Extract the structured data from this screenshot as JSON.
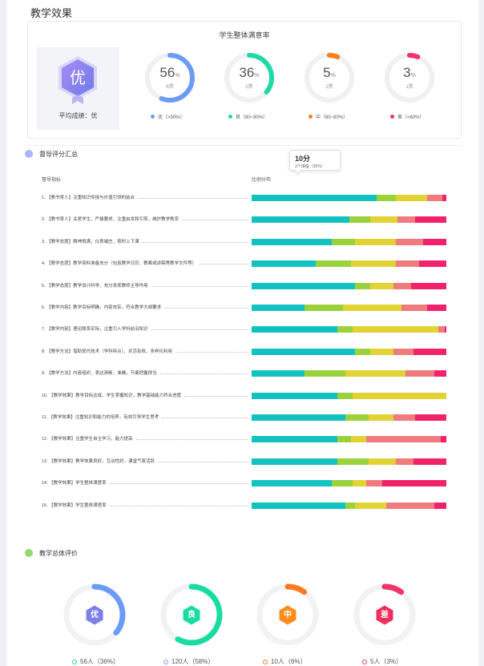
{
  "page": {
    "title": "教学效果"
  },
  "rate_card": {
    "title": "学生整体满意率",
    "grade": {
      "badge": "优",
      "avg_text": "平均成绩：优"
    },
    "donuts": [
      {
        "key": "excellent",
        "percent": 56,
        "unit": "%",
        "count": "6票",
        "color": "#6b9bf7"
      },
      {
        "key": "good",
        "percent": 36,
        "unit": "%",
        "count": "5票",
        "color": "#20d9a8"
      },
      {
        "key": "medium",
        "percent": 5,
        "unit": "%",
        "count": "2票",
        "color": "#fb7b21"
      },
      {
        "key": "poor",
        "percent": 3,
        "unit": "%",
        "count": "1票",
        "color": "#f0336a"
      }
    ],
    "legend": [
      {
        "text": "优（>90%）",
        "color": "#6b9bf7"
      },
      {
        "text": "良（80~90%）",
        "color": "#20d9a8"
      },
      {
        "text": "中（60~80%）",
        "color": "#fb7b21"
      },
      {
        "text": "差（<60%）",
        "color": "#f0336a"
      }
    ]
  },
  "supervision": {
    "heading": "督导评分汇总",
    "icon_color": "#a9b6f5",
    "col_indicator": "督导指标",
    "col_dist": "比例分布",
    "tooltip": {
      "main": "10分",
      "sub": "3个课程（36%）"
    },
    "segment_colors": [
      "#11c2c0",
      "#9bd23c",
      "#e2d334",
      "#ef7b7f",
      "#f2226a"
    ],
    "rows": [
      {
        "label": "1. 【教书育人】注重知识传授与价值引领的结合",
        "dist": [
          64,
          10,
          16,
          8,
          2
        ]
      },
      {
        "label": "2. 【教书育人】关爱学生，严格要求，注重启发和引导，维护教学秩序",
        "dist": [
          50,
          11,
          14,
          9,
          16
        ]
      },
      {
        "label": "3. 【教学态度】精神饱满，仪表端庄，按时上下课",
        "dist": [
          41,
          12,
          21,
          14,
          12
        ]
      },
      {
        "label": "4. 【教学态度】教学资料准备充分（包括教学日历、教案或讲稿等教学文件等）",
        "dist": [
          33,
          18,
          23,
          12,
          14
        ]
      },
      {
        "label": "5. 【教学态度】教学设计科学，充分发挥教师主导作用",
        "dist": [
          53,
          8,
          12,
          9,
          18
        ]
      },
      {
        "label": "6. 【教学内容】教学目标明确，内容充实，符合教学大纲要求",
        "dist": [
          27,
          20,
          30,
          13,
          10
        ]
      },
      {
        "label": "7. 【教学内容】理论联系实际，注重引入学科前沿知识",
        "dist": [
          44,
          8,
          44,
          3,
          1
        ]
      },
      {
        "label": "8. 【教学方法】借助现代技术（学科特点），灵活有效，多样化利用",
        "dist": [
          53,
          8,
          12,
          10,
          17
        ]
      },
      {
        "label": "9. 【教学方法】内容组织、表达清晰，准确，节奏把握得当",
        "dist": [
          27,
          21,
          31,
          15,
          6
        ]
      },
      {
        "label": "10. 【教学效果】教学目标达成，学生掌握知识，教学基础能力符合进度",
        "dist": [
          44,
          8,
          48,
          0,
          0
        ]
      },
      {
        "label": "11. 【教学效果】注重知识和能力的培养，有效引导学生思考",
        "dist": [
          48,
          12,
          13,
          11,
          16
        ]
      },
      {
        "label": "12. 【教学效果】注重学生自主学习，能力提高",
        "dist": [
          44,
          7,
          8,
          38,
          3
        ]
      },
      {
        "label": "13. 【教学效果】教学效果良好，互动性好，课堂气氛活跃",
        "dist": [
          44,
          16,
          14,
          9,
          17
        ]
      },
      {
        "label": "14. 【教学效果】学生整体满意率",
        "dist": [
          41,
          11,
          7,
          8,
          33
        ]
      },
      {
        "label": "15. 【教学效果】学生整体满意率",
        "dist": [
          48,
          5,
          16,
          25,
          6
        ]
      }
    ]
  },
  "overall": {
    "heading": "教学总体评价",
    "icon_color": "#8fd96d",
    "items": [
      {
        "key": "excellent",
        "badge": "优",
        "fraction": 0.36,
        "color": "#6b9bf7",
        "badge_color": "#7c80e8",
        "legend": "56人（36%）",
        "legend_color": "#20d9a8"
      },
      {
        "key": "good",
        "badge": "良",
        "fraction": 0.58,
        "color": "#18dca0",
        "badge_color": "#18dca0",
        "legend": "120人（58%）",
        "legend_color": "#6b9bf7"
      },
      {
        "key": "medium",
        "badge": "中",
        "fraction": 0.06,
        "color": "#fb7b21",
        "badge_color": "#fb8c1c",
        "legend": "10人（6%）",
        "legend_color": "#fb7b21"
      },
      {
        "key": "poor",
        "badge": "差",
        "fraction": 0.03,
        "color": "#f0336a",
        "badge_color": "#ef2f5c",
        "legend": "5人（3%）",
        "legend_color": "#f0336a"
      }
    ]
  }
}
